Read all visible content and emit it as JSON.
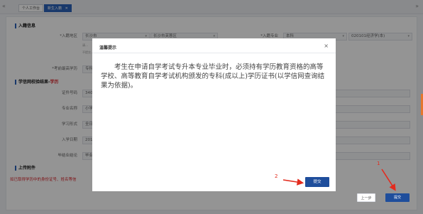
{
  "tabbar": {
    "left_nav": "«",
    "right_nav": "»",
    "tabs": [
      {
        "label": "个人工作台",
        "active": false
      },
      {
        "label": "新生入籍",
        "active": true,
        "close": "✕"
      }
    ]
  },
  "form": {
    "section_enroll": "入籍信息",
    "region_label": "*入籍地区",
    "region_city": "长沙市",
    "region_district": "长沙市芙蓉区",
    "major_label": "*入籍专业",
    "major_level": "本科",
    "major_value": "020101经济学(本)",
    "hint1": "请…",
    "hint2": "不提交…",
    "prior_edu_label": "*考前最高学历",
    "prior_edu_value": "专科",
    "section_verify": "学信网校验结果-",
    "section_verify_red": "学历",
    "cert_label": "证件号码",
    "cert_value": "340",
    "spec_label": "专业名称",
    "spec_value": "小学",
    "form_label": "学习形式",
    "form_value": "全日",
    "enter_label": "入学日期",
    "enter_value": "201",
    "grad_label": "毕结业结论",
    "grad_value": "毕业",
    "section_upload": "上传附件",
    "upload_hint": "如已取得学历中的身份证号、姓名等信",
    "prev_button": "上一步",
    "submit_button": "提交"
  },
  "modal": {
    "title": "温馨提示",
    "close": "×",
    "body": "考生在申请自学考试专升本专业毕业时，必须持有学历教育资格的高等学校、高等教育自学考试机构颁发的专科(成以上)学历证书(以学信网查询结果为依据)。",
    "ok_button": "提交"
  },
  "annotations": {
    "step1": "1",
    "step2": "2",
    "color": "#e32b1e"
  }
}
